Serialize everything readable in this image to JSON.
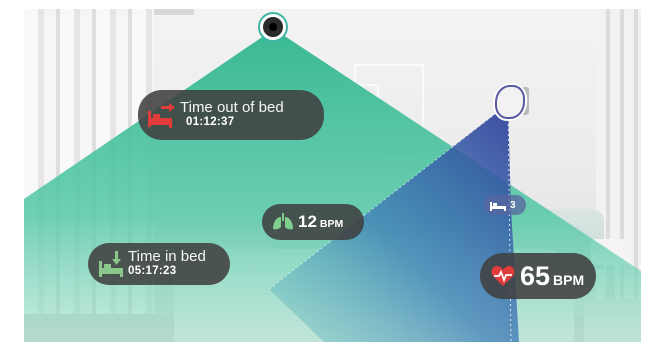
{
  "time_out_of_bed": {
    "label": "Time out of bed",
    "value": "01:12:37"
  },
  "time_in_bed": {
    "label": "Time in bed",
    "value": "05:17:23"
  },
  "breathing": {
    "value": "12",
    "unit": "BPM"
  },
  "heart_rate": {
    "value": "65",
    "unit": "BPM"
  },
  "occupancy": {
    "value": "3"
  },
  "icons": {
    "out_of_bed": "bed-arrow-out-icon",
    "in_bed": "bed-arrow-in-icon",
    "breathing": "lungs-icon",
    "heart": "heart-pulse-icon",
    "occupancy": "bed-icon"
  },
  "colors": {
    "teal_cone": "#3fc3a1",
    "blue_cone": "#3f5fb0",
    "red_accent": "#e23b3b",
    "green_accent": "#8bc78b",
    "pill_bg": "#404040"
  }
}
